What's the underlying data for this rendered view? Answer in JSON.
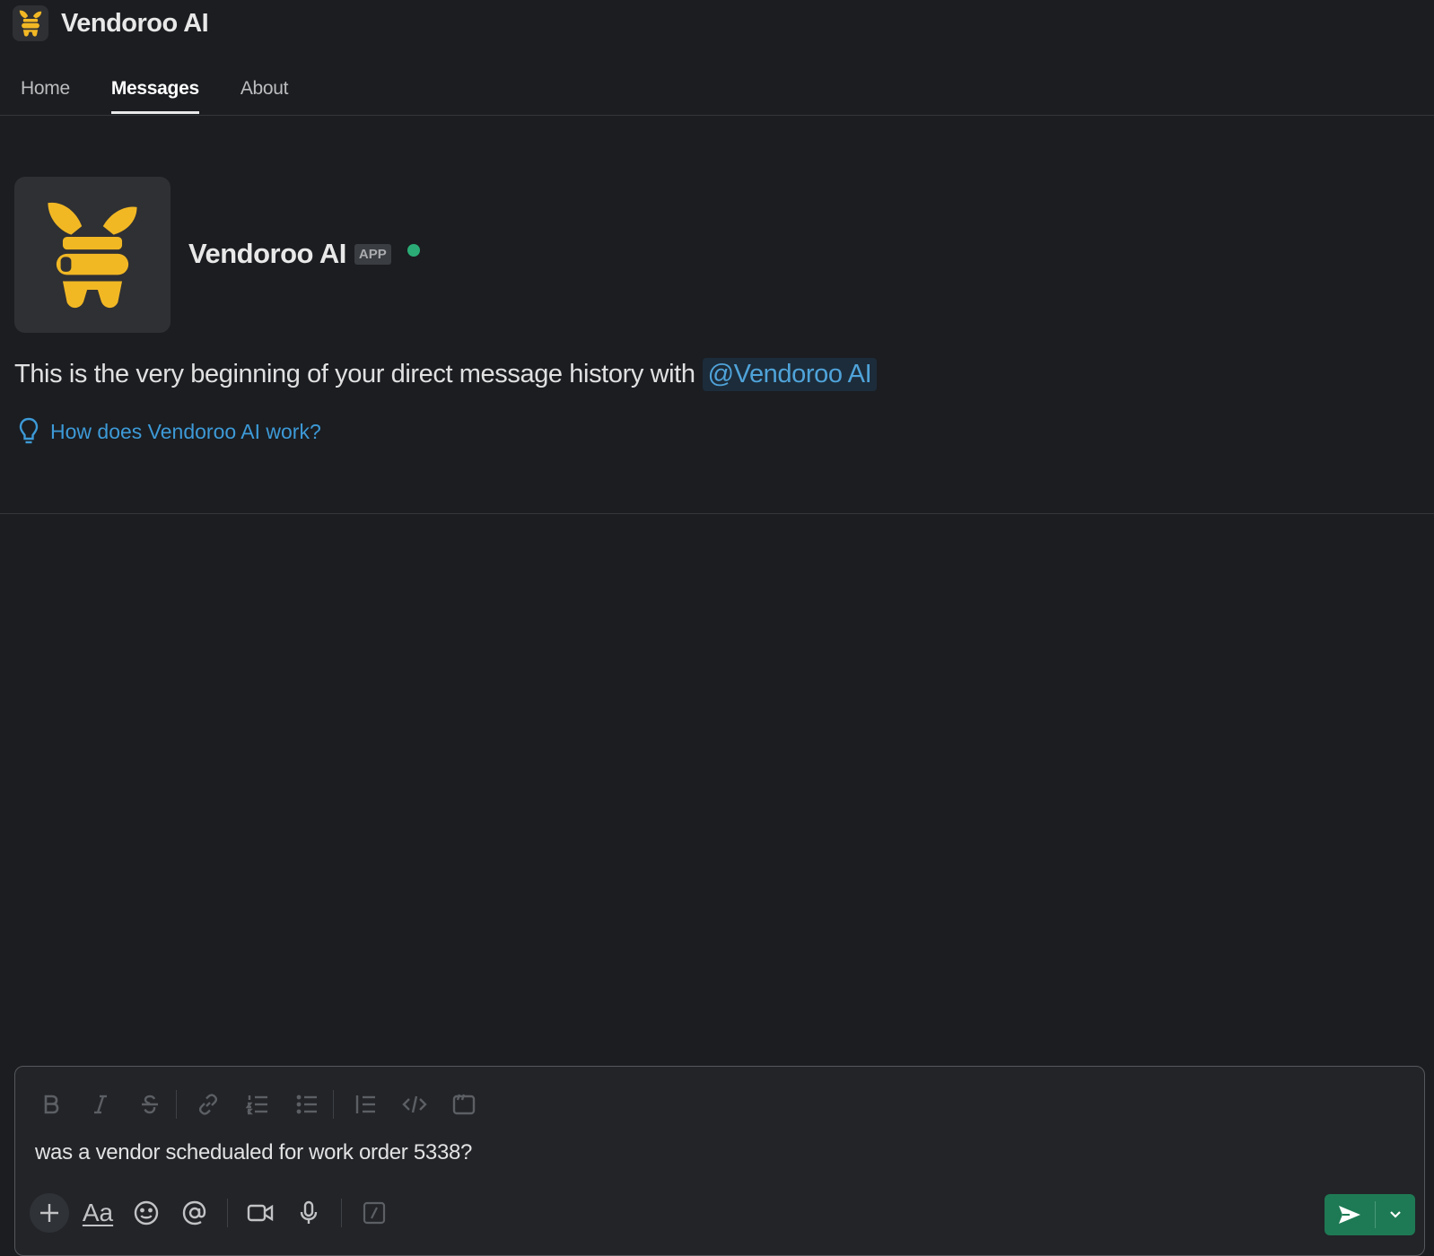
{
  "header": {
    "app_title": "Vendoroo AI",
    "logo_icon": "vendoroo-logo-icon"
  },
  "tabs": [
    {
      "label": "Home",
      "active": false
    },
    {
      "label": "Messages",
      "active": true
    },
    {
      "label": "About",
      "active": false
    }
  ],
  "intro": {
    "bot_name": "Vendoroo AI",
    "badge": "APP",
    "status": "online",
    "history_text": "This is the very beginning of your direct message history with",
    "mention": "@Vendoroo AI",
    "help_link": "How does Vendoroo AI work?"
  },
  "composer": {
    "message_value": "was a vendor schedualed for work order 5338?",
    "format_tools": [
      "bold-icon",
      "italic-icon",
      "strikethrough-icon",
      "link-icon",
      "ordered-list-icon",
      "bulleted-list-icon",
      "blockquote-icon",
      "code-icon",
      "code-block-icon"
    ],
    "formatting_label": "Aa"
  },
  "colors": {
    "background": "#1b1d21",
    "accent_link": "#3d9ad7",
    "brand_yellow": "#f2b824",
    "online_green": "#2bac76",
    "send_green": "#1e7a54"
  }
}
